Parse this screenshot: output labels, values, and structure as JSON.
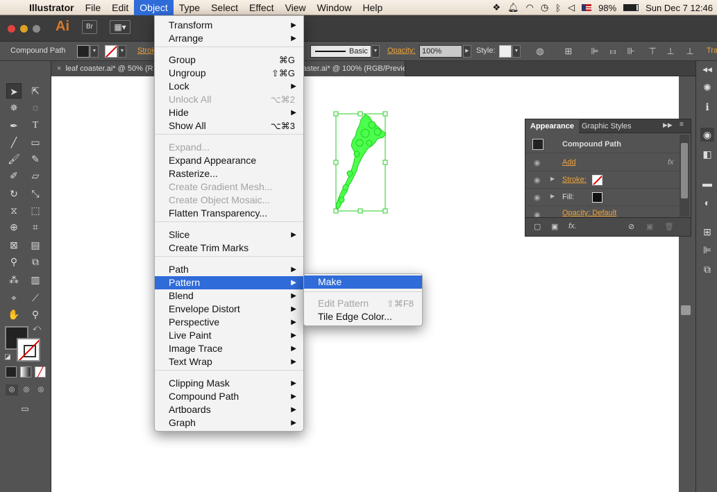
{
  "menubar": {
    "apple": "",
    "items": [
      {
        "label": "Illustrator"
      },
      {
        "label": "File"
      },
      {
        "label": "Edit"
      },
      {
        "label": "Object"
      },
      {
        "label": "Type"
      },
      {
        "label": "Select"
      },
      {
        "label": "Effect"
      },
      {
        "label": "View"
      },
      {
        "label": "Window"
      },
      {
        "label": "Help"
      }
    ],
    "battery": "98%",
    "clock": "Sun Dec 7  12:46"
  },
  "appbar": {
    "logo": "Ai",
    "bridge": "Br"
  },
  "control": {
    "object_type": "Compound Path",
    "stroke_label": "Stroke",
    "brush": "Basic",
    "opacity_label": "Opacity:",
    "opacity_value": "100%",
    "style_label": "Style:",
    "transform_label": "Tra"
  },
  "tabs": [
    {
      "label": "leaf coaster.ai* @ 50% (R"
    },
    {
      "label": "aster.ai* @ 100% (RGB/Preview)"
    }
  ],
  "object_menu": {
    "items": [
      {
        "label": "Transform",
        "shortcut": "",
        "submenu": true,
        "disabled": false
      },
      {
        "label": "Arrange",
        "shortcut": "",
        "submenu": true,
        "disabled": false
      },
      {
        "label": "Group",
        "shortcut": "⌘G",
        "submenu": false,
        "disabled": false
      },
      {
        "label": "Ungroup",
        "shortcut": "⇧⌘G",
        "submenu": false,
        "disabled": false
      },
      {
        "label": "Lock",
        "shortcut": "",
        "submenu": true,
        "disabled": false
      },
      {
        "label": "Unlock All",
        "shortcut": "⌥⌘2",
        "submenu": false,
        "disabled": true
      },
      {
        "label": "Hide",
        "shortcut": "",
        "submenu": true,
        "disabled": false
      },
      {
        "label": "Show All",
        "shortcut": "⌥⌘3",
        "submenu": false,
        "disabled": false
      },
      {
        "label": "Expand...",
        "shortcut": "",
        "submenu": false,
        "disabled": true
      },
      {
        "label": "Expand Appearance",
        "shortcut": "",
        "submenu": false,
        "disabled": false
      },
      {
        "label": "Rasterize...",
        "shortcut": "",
        "submenu": false,
        "disabled": false
      },
      {
        "label": "Create Gradient Mesh...",
        "shortcut": "",
        "submenu": false,
        "disabled": true
      },
      {
        "label": "Create Object Mosaic...",
        "shortcut": "",
        "submenu": false,
        "disabled": true
      },
      {
        "label": "Flatten Transparency...",
        "shortcut": "",
        "submenu": false,
        "disabled": false
      },
      {
        "label": "Slice",
        "shortcut": "",
        "submenu": true,
        "disabled": false
      },
      {
        "label": "Create Trim Marks",
        "shortcut": "",
        "submenu": false,
        "disabled": false
      },
      {
        "label": "Path",
        "shortcut": "",
        "submenu": true,
        "disabled": false
      },
      {
        "label": "Pattern",
        "shortcut": "",
        "submenu": true,
        "disabled": false
      },
      {
        "label": "Blend",
        "shortcut": "",
        "submenu": true,
        "disabled": false
      },
      {
        "label": "Envelope Distort",
        "shortcut": "",
        "submenu": true,
        "disabled": false
      },
      {
        "label": "Perspective",
        "shortcut": "",
        "submenu": true,
        "disabled": false
      },
      {
        "label": "Live Paint",
        "shortcut": "",
        "submenu": true,
        "disabled": false
      },
      {
        "label": "Image Trace",
        "shortcut": "",
        "submenu": true,
        "disabled": false
      },
      {
        "label": "Text Wrap",
        "shortcut": "",
        "submenu": true,
        "disabled": false
      },
      {
        "label": "Clipping Mask",
        "shortcut": "",
        "submenu": true,
        "disabled": false
      },
      {
        "label": "Compound Path",
        "shortcut": "",
        "submenu": true,
        "disabled": false
      },
      {
        "label": "Artboards",
        "shortcut": "",
        "submenu": true,
        "disabled": false
      },
      {
        "label": "Graph",
        "shortcut": "",
        "submenu": true,
        "disabled": false
      }
    ]
  },
  "pattern_submenu": {
    "items": [
      {
        "label": "Make",
        "shortcut": "",
        "disabled": false
      },
      {
        "label": "Edit Pattern",
        "shortcut": "⇧⌘F8",
        "disabled": true
      },
      {
        "label": "Tile Edge Color...",
        "shortcut": "",
        "disabled": false
      }
    ]
  },
  "appearance": {
    "tabs": [
      {
        "label": "Appearance"
      },
      {
        "label": "Graphic Styles"
      }
    ],
    "title": "Compound Path",
    "add": "Add",
    "stroke": "Stroke:",
    "fill": "Fill:",
    "opacity": "Opacity: Default",
    "fx": "fx",
    "fx_menu": "fx."
  },
  "colors": {
    "menu_highlight": "#2f6bd9",
    "leaf": "#4cff4c",
    "selection": "#22cc22"
  }
}
